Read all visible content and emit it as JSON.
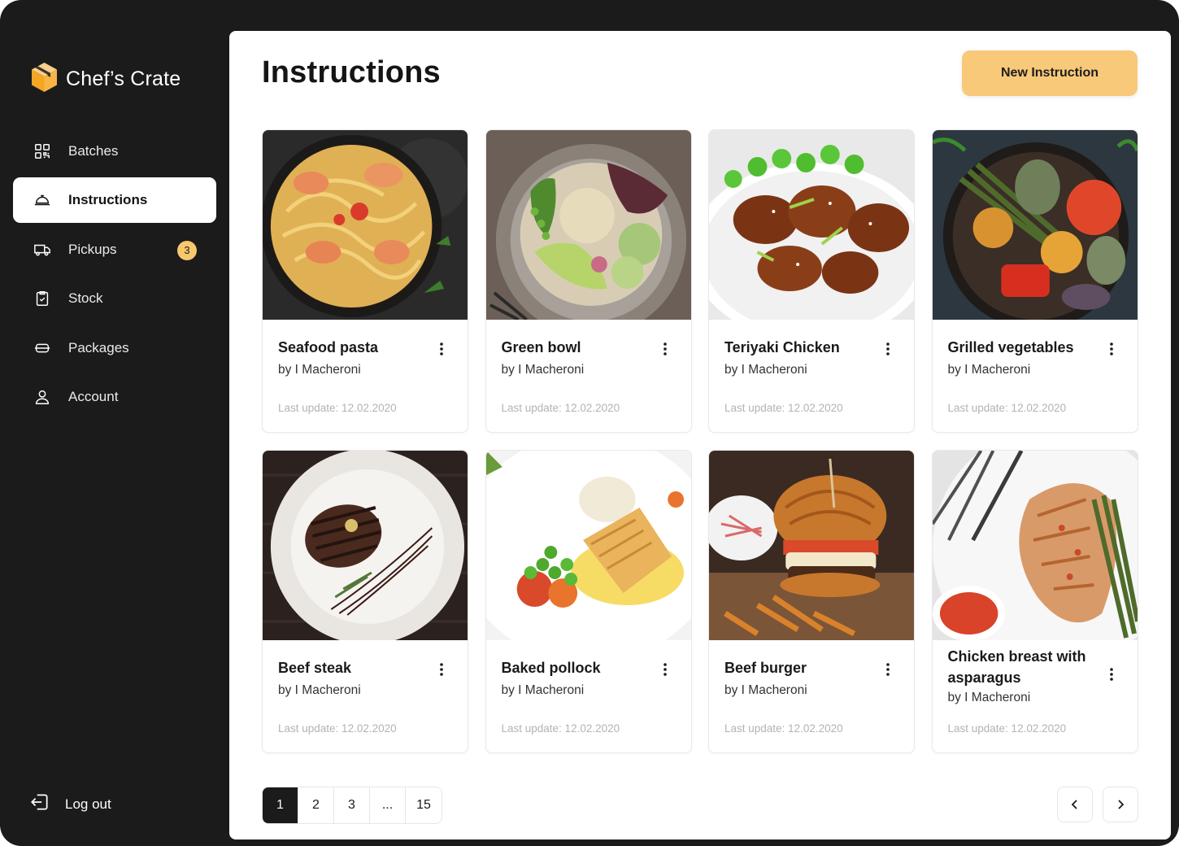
{
  "app": {
    "name": "Chef’s Crate",
    "brand_color": "#f8b544",
    "accent_color": "#f9c97a",
    "sidebar_bg": "#1b1b1b"
  },
  "sidebar": {
    "items": [
      {
        "label": "Batches",
        "icon": "qr-grid-icon",
        "active": false
      },
      {
        "label": "Instructions",
        "icon": "cloche-icon",
        "active": true
      },
      {
        "label": "Pickups",
        "icon": "truck-icon",
        "active": false,
        "badge": "3"
      },
      {
        "label": "Stock",
        "icon": "clipboard-check-icon",
        "active": false
      },
      {
        "label": "Packages",
        "icon": "package-icon",
        "active": false
      },
      {
        "label": "Account",
        "icon": "user-icon",
        "active": false
      }
    ],
    "logout_label": "Log out"
  },
  "header": {
    "title": "Instructions",
    "new_button_label": "New Instruction"
  },
  "cards": [
    {
      "title": "Seafood pasta",
      "author": "by I Macheroni",
      "updated": "Last update: 12.02.2020",
      "image": "seafood-pasta-photo"
    },
    {
      "title": "Green bowl",
      "author": "by I Macheroni",
      "updated": "Last update: 12.02.2020",
      "image": "green-bowl-photo"
    },
    {
      "title": "Teriyaki Chicken",
      "author": "by I Macheroni",
      "updated": "Last update: 12.02.2020",
      "image": "teriyaki-chicken-photo"
    },
    {
      "title": "Grilled vegetables",
      "author": "by I Macheroni",
      "updated": "Last update: 12.02.2020",
      "image": "grilled-vegetables-photo"
    },
    {
      "title": "Beef steak",
      "author": "by I Macheroni",
      "updated": "Last update: 12.02.2020",
      "image": "beef-steak-photo"
    },
    {
      "title": "Baked pollock",
      "author": "by I Macheroni",
      "updated": "Last update: 12.02.2020",
      "image": "baked-pollock-photo"
    },
    {
      "title": "Beef burger",
      "author": "by I Macheroni",
      "updated": "Last update: 12.02.2020",
      "image": "beef-burger-photo"
    },
    {
      "title": "Chicken breast with asparagus",
      "author": "by I Macheroni",
      "updated": "Last update: 12.02.2020",
      "image": "chicken-breast-photo"
    }
  ],
  "pagination": {
    "pages": [
      "1",
      "2",
      "3",
      "...",
      "15"
    ],
    "current": "1",
    "prev_icon": "chevron-left-icon",
    "next_icon": "chevron-right-icon"
  }
}
